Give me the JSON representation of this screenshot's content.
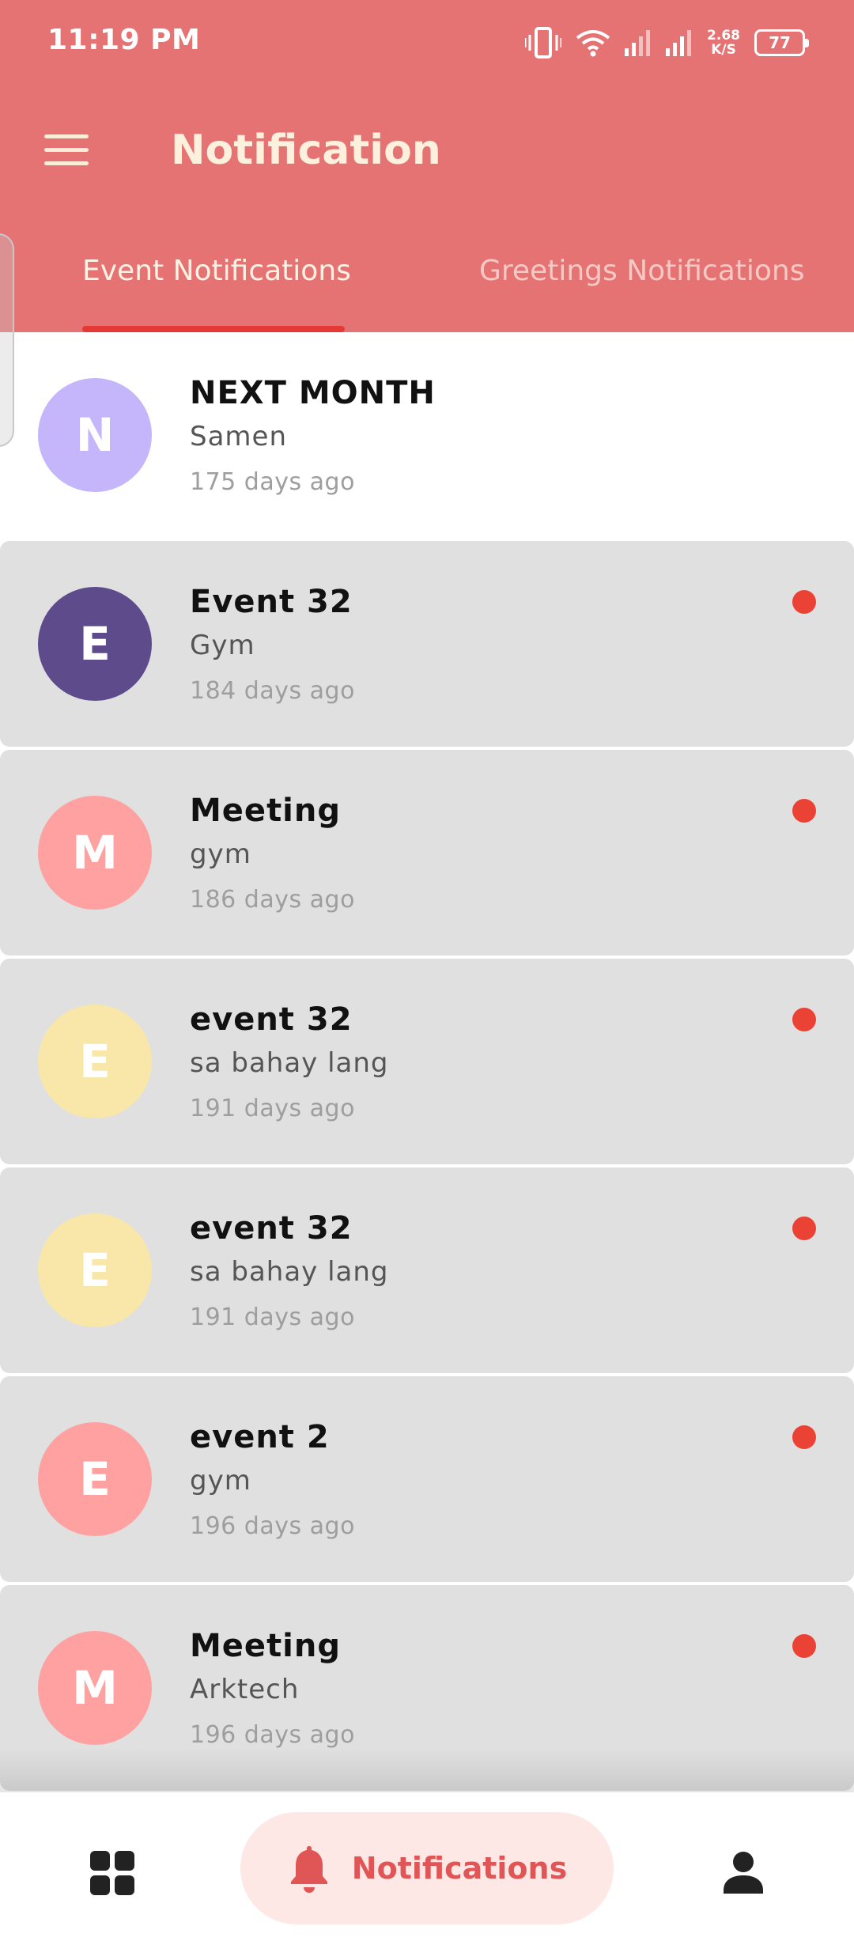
{
  "status_bar": {
    "time": "11:19 PM",
    "net_speed_value": "2.68",
    "net_speed_unit": "K/S",
    "battery": "77",
    "battery_level": 0.77
  },
  "app_bar": {
    "title": "Notification",
    "menu_icon": "hamburger-menu-icon"
  },
  "tabs": [
    {
      "label": "Event Notifications",
      "active": true
    },
    {
      "label": "Greetings Notifications",
      "active": false
    }
  ],
  "notifications": [
    {
      "initial": "N",
      "title": "NEXT MONTH",
      "subtitle": "Samen",
      "time": "175 days ago",
      "avatar_color": "#c5b6fb",
      "unread": false
    },
    {
      "initial": "E",
      "title": "Event 32",
      "subtitle": "Gym",
      "time": "184 days ago",
      "avatar_color": "#5e4b8b",
      "unread": true
    },
    {
      "initial": "M",
      "title": "Meeting",
      "subtitle": "gym",
      "time": "186 days ago",
      "avatar_color": "#ffa1a1",
      "unread": true
    },
    {
      "initial": "E",
      "title": "event 32",
      "subtitle": "sa bahay lang",
      "time": "191 days ago",
      "avatar_color": "#f8e7a8",
      "unread": true
    },
    {
      "initial": "E",
      "title": "event 32",
      "subtitle": "sa bahay lang",
      "time": "191 days ago",
      "avatar_color": "#f8e7a8",
      "unread": true
    },
    {
      "initial": "E",
      "title": "event 2",
      "subtitle": "gym",
      "time": "196 days ago",
      "avatar_color": "#ffa1a1",
      "unread": true
    },
    {
      "initial": "M",
      "title": "Meeting",
      "subtitle": "Arktech",
      "time": "196 days ago",
      "avatar_color": "#ffa1a1",
      "unread": true
    }
  ],
  "bottom_nav": {
    "dashboard_icon": "dashboard-grid-icon",
    "notifications_label": "Notifications",
    "notifications_icon": "bell-icon",
    "profile_icon": "person-icon"
  },
  "colors": {
    "header": "#e57373",
    "accent": "#e53935",
    "unread_dot": "#ea4335",
    "unread_bg": "#e0e0e0",
    "nav_pill": "#fde8e6"
  }
}
